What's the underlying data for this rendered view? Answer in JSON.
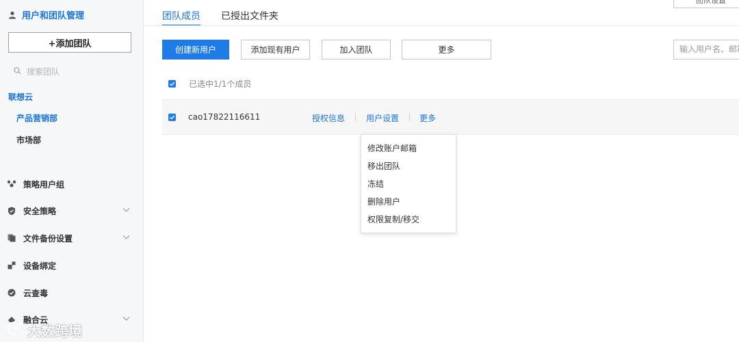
{
  "sidebar": {
    "title": "用户和团队管理",
    "add_team": "+添加团队",
    "search_placeholder": "搜索团队",
    "org": "联想云",
    "teams": [
      "产品营销部",
      "市场部"
    ],
    "nav": [
      {
        "label": "策略用户组",
        "icon": "users-group-icon",
        "expandable": false
      },
      {
        "label": "安全策略",
        "icon": "shield-icon",
        "expandable": true
      },
      {
        "label": "文件备份设置",
        "icon": "files-icon",
        "expandable": true
      },
      {
        "label": "设备绑定",
        "icon": "device-link-icon",
        "expandable": false
      },
      {
        "label": "云查毒",
        "icon": "check-circle-icon",
        "expandable": false
      },
      {
        "label": "融合云",
        "icon": "cloud-icon",
        "expandable": true
      }
    ]
  },
  "tabs": [
    "团队成员",
    "已授出文件夹"
  ],
  "team_settings": "团队设置",
  "toolbar": {
    "create_user": "创建新用户",
    "add_existing": "添加现有用户",
    "join_team": "加入团队",
    "more": "更多"
  },
  "search_user_placeholder": "输入用户名、邮箱",
  "selection": {
    "text": "已选中1/1个成员"
  },
  "member": {
    "username": "cao17822116611",
    "actions": [
      "授权信息",
      "用户设置",
      "更多"
    ]
  },
  "more_menu": [
    "修改账户邮箱",
    "移出团队",
    "冻结",
    "删除用户",
    "权限复制/移交"
  ],
  "watermark": "大数跨境",
  "colors": {
    "accent": "#1f7be8",
    "sidebar_bg": "#f6f7f9"
  }
}
